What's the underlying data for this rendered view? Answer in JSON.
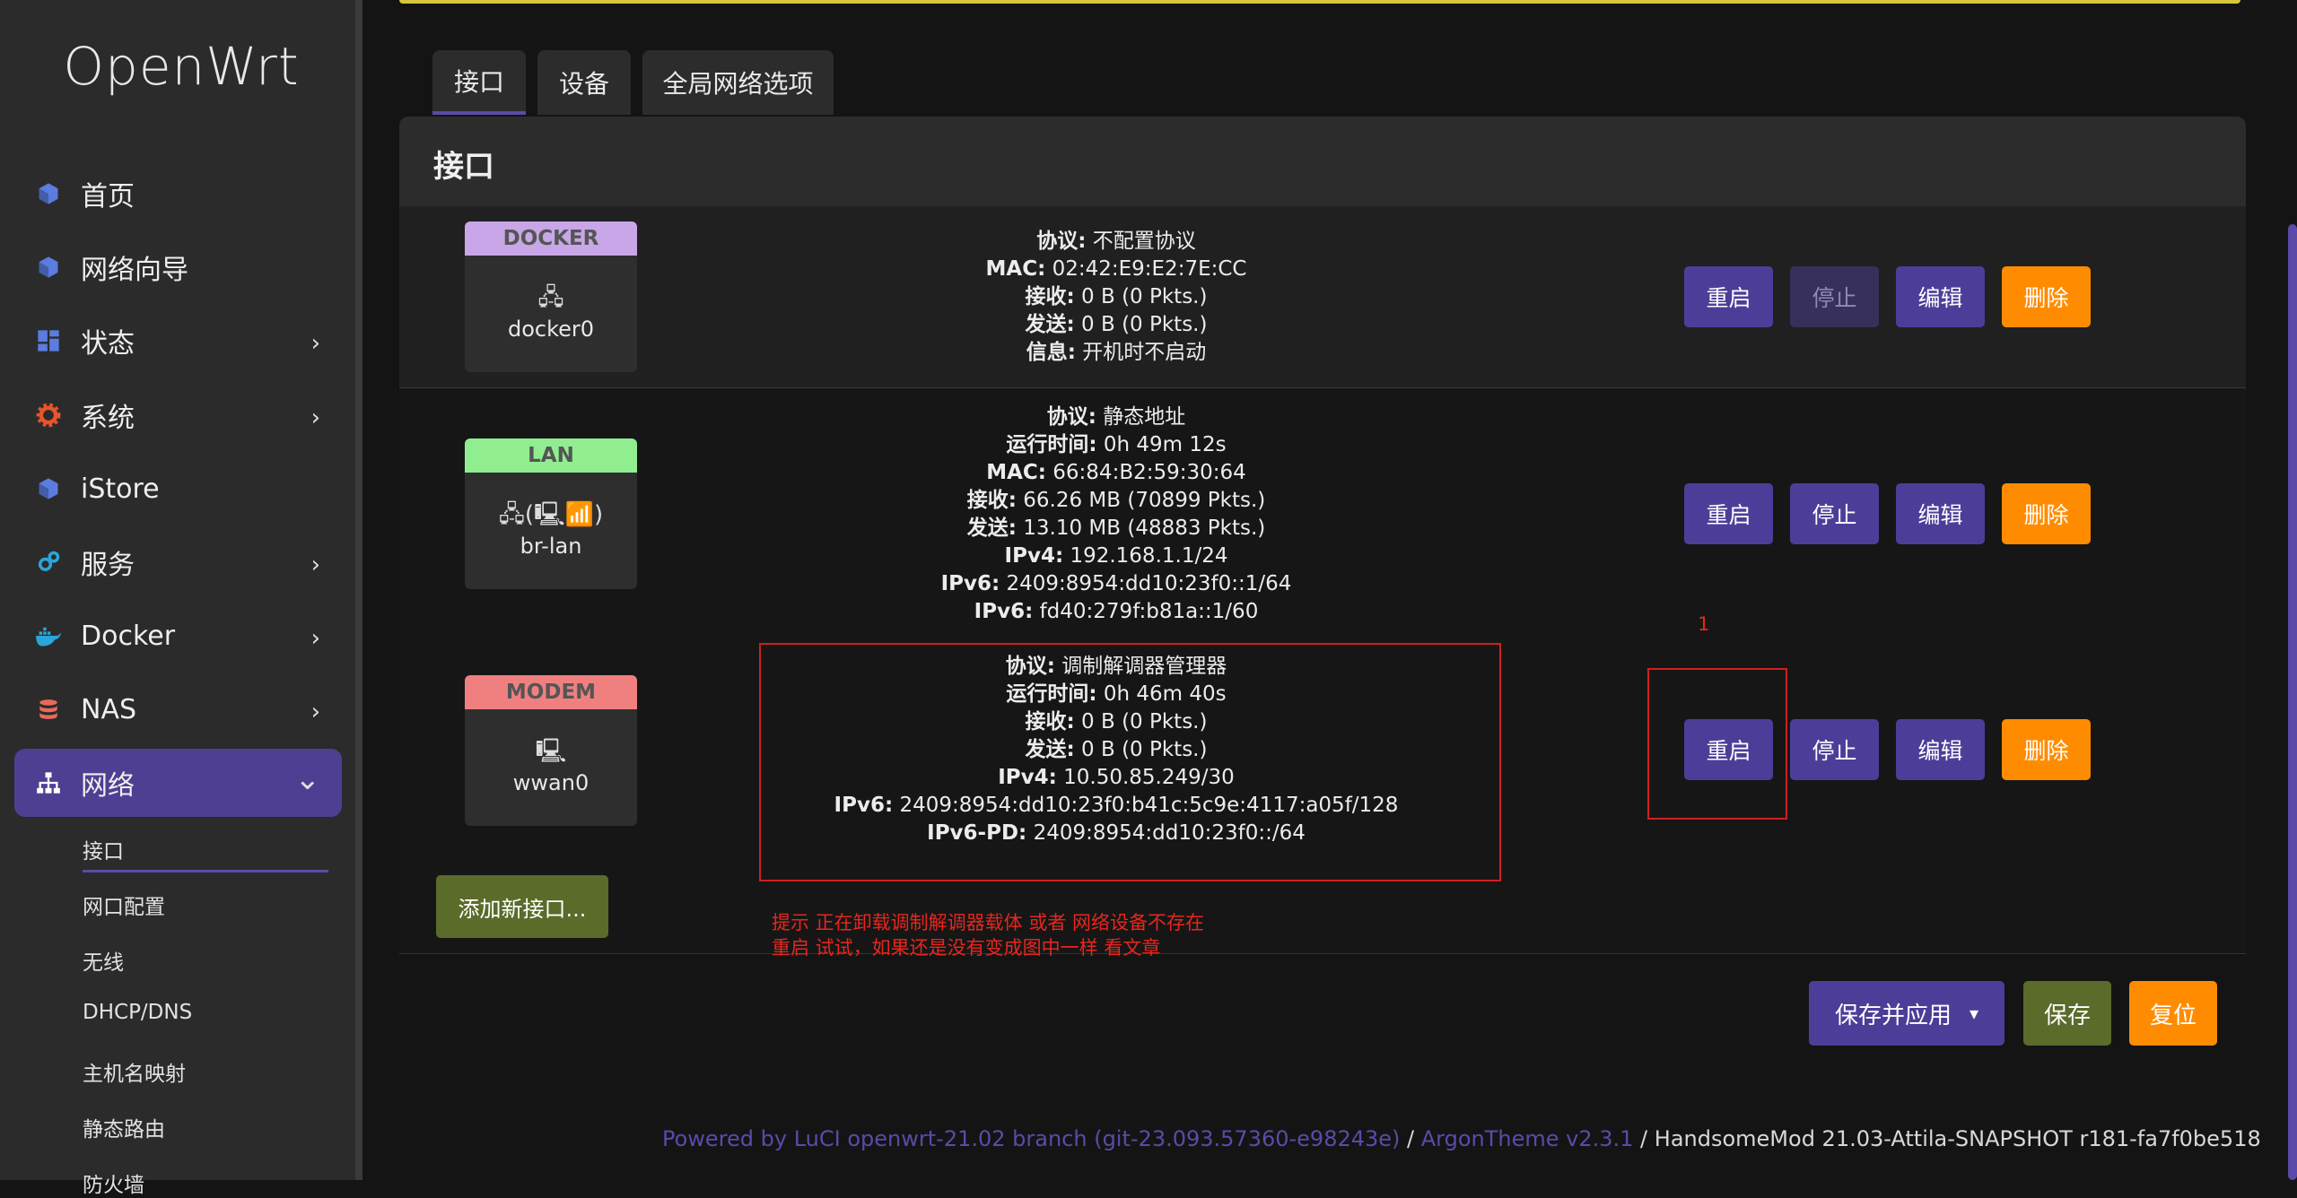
{
  "brand": {
    "logo": "OpenWrt"
  },
  "sidebar": {
    "items": [
      {
        "label": "首页",
        "icon": "cube-icon",
        "color": "#5b7ce0",
        "chevron": ""
      },
      {
        "label": "网络向导",
        "icon": "cube-icon",
        "color": "#5b7ce0",
        "chevron": ""
      },
      {
        "label": "状态",
        "icon": "dashboard-icon",
        "color": "#5b7ce0",
        "chevron": "›"
      },
      {
        "label": "系统",
        "icon": "gear-icon",
        "color": "#e8542c",
        "chevron": "›"
      },
      {
        "label": "iStore",
        "icon": "cube-icon",
        "color": "#5b7ce0",
        "chevron": ""
      },
      {
        "label": "服务",
        "icon": "gears-icon",
        "color": "#2aa6d9",
        "chevron": "›"
      },
      {
        "label": "Docker",
        "icon": "docker-icon",
        "color": "#2aa6d9",
        "chevron": "›"
      },
      {
        "label": "NAS",
        "icon": "database-icon",
        "color": "#e86a5a",
        "chevron": "›"
      },
      {
        "label": "网络",
        "icon": "sitemap-icon",
        "color": "#ffffff",
        "chevron": "⌄"
      }
    ],
    "subitems": [
      "接口",
      "网口配置",
      "无线",
      "DHCP/DNS",
      "主机名映射",
      "静态路由",
      "防火墙"
    ]
  },
  "tabs": [
    "接口",
    "设备",
    "全局网络选项"
  ],
  "panel": {
    "title": "接口"
  },
  "interfaces": [
    {
      "name": "DOCKER",
      "badge_color": "#c9a6e8",
      "device": "docker0",
      "icon": "🖧",
      "info": [
        {
          "k": "协议:",
          "v": "不配置协议"
        },
        {
          "k": "MAC:",
          "v": "02:42:E9:E2:7E:CC"
        },
        {
          "k": "接收:",
          "v": "0 B (0 Pkts.)"
        },
        {
          "k": "发送:",
          "v": "0 B (0 Pkts.)"
        },
        {
          "k": "信息:",
          "v": "开机时不启动"
        }
      ],
      "stop_disabled": true
    },
    {
      "name": "LAN",
      "badge_color": "#90ee90",
      "device": "br-lan",
      "icon": "🖧(🖳📶)",
      "info": [
        {
          "k": "协议:",
          "v": "静态地址"
        },
        {
          "k": "运行时间:",
          "v": "0h 49m 12s"
        },
        {
          "k": "MAC:",
          "v": "66:84:B2:59:30:64"
        },
        {
          "k": "接收:",
          "v": "66.26 MB (70899 Pkts.)"
        },
        {
          "k": "发送:",
          "v": "13.10 MB (48883 Pkts.)"
        },
        {
          "k": "IPv4:",
          "v": "192.168.1.1/24"
        },
        {
          "k": "IPv6:",
          "v": "2409:8954:dd10:23f0::1/64"
        },
        {
          "k": "IPv6:",
          "v": "fd40:279f:b81a::1/60"
        }
      ],
      "stop_disabled": false
    },
    {
      "name": "MODEM",
      "badge_color": "#f08080",
      "device": "wwan0",
      "icon": "🖳",
      "info": [
        {
          "k": "协议:",
          "v": "调制解调器管理器"
        },
        {
          "k": "运行时间:",
          "v": "0h 46m 40s"
        },
        {
          "k": "接收:",
          "v": "0 B (0 Pkts.)"
        },
        {
          "k": "发送:",
          "v": "0 B (0 Pkts.)"
        },
        {
          "k": "IPv4:",
          "v": "10.50.85.249/30"
        },
        {
          "k": "IPv6:",
          "v": "2409:8954:dd10:23f0:b41c:5c9e:4117:a05f/128"
        },
        {
          "k": "IPv6-PD:",
          "v": "2409:8954:dd10:23f0::/64"
        }
      ],
      "stop_disabled": false
    }
  ],
  "actions": {
    "restart": "重启",
    "stop": "停止",
    "edit": "编辑",
    "delete": "删除"
  },
  "annotation": {
    "marker": "1",
    "note_line1": "提示   正在卸载调制解调器载体 或者 网络设备不存在",
    "note_line2": "重启 试试，如果还是没有变成图中一样 看文章"
  },
  "add_interface": "添加新接口...",
  "footer_actions": {
    "save_apply": "保存并应用",
    "save_apply_arrow": "▾",
    "save": "保存",
    "reset": "复位"
  },
  "footer": {
    "powered": "Powered by LuCI openwrt-21.02 branch (git-23.093.57360-e98243e)",
    "sep1": " / ",
    "theme": "ArgonTheme v2.3.1",
    "sep2": " / ",
    "mod": "HandsomeMod 21.03-Attila-SNAPSHOT r181-fa7f0be518"
  }
}
